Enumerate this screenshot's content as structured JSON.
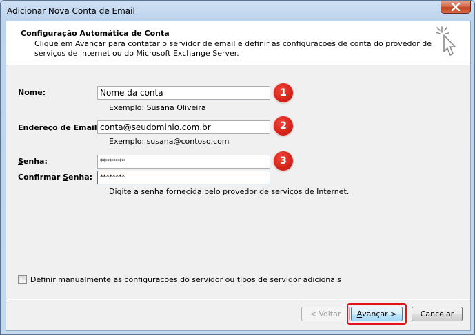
{
  "window": {
    "title": "Adicionar Nova Conta de Email"
  },
  "header": {
    "title": "Configuração Automática de Conta",
    "description": "Clique em Avançar para contatar o servidor de email e definir as configurações de conta do provedor de serviços de Internet ou do Microsoft Exchange Server.",
    "icon": "wizard-cursor-icon"
  },
  "form": {
    "name": {
      "label_access": "N",
      "label_rest": "ome:",
      "value": "Nome da conta",
      "example": "Exemplo: Susana Oliveira",
      "step": "1"
    },
    "email": {
      "label_pre": "Endereço de ",
      "label_access": "E",
      "label_rest": "mail:",
      "value": "conta@seudominio.com.br",
      "example": "Exemplo: susana@contoso.com",
      "step": "2"
    },
    "password": {
      "label_access": "S",
      "label_rest": "enha:",
      "value": "********",
      "step": "3"
    },
    "confirm": {
      "label_pre": "Confirmar ",
      "label_access": "S",
      "label_rest": "enha:",
      "value": "********",
      "hint": "Digite a senha fornecida pelo provedor de serviços de Internet."
    },
    "manual": {
      "label_pre": "Definir ",
      "label_access": "m",
      "label_rest": "anualmente as configurações do servidor ou tipos de servidor adicionais",
      "checked": false
    }
  },
  "buttons": {
    "back": "< Voltar",
    "next_pre": "",
    "next_access": "A",
    "next_rest": "vançar >",
    "cancel": "Cancelar"
  },
  "colors": {
    "badge": "#d8261d",
    "highlight": "#e0121e"
  }
}
